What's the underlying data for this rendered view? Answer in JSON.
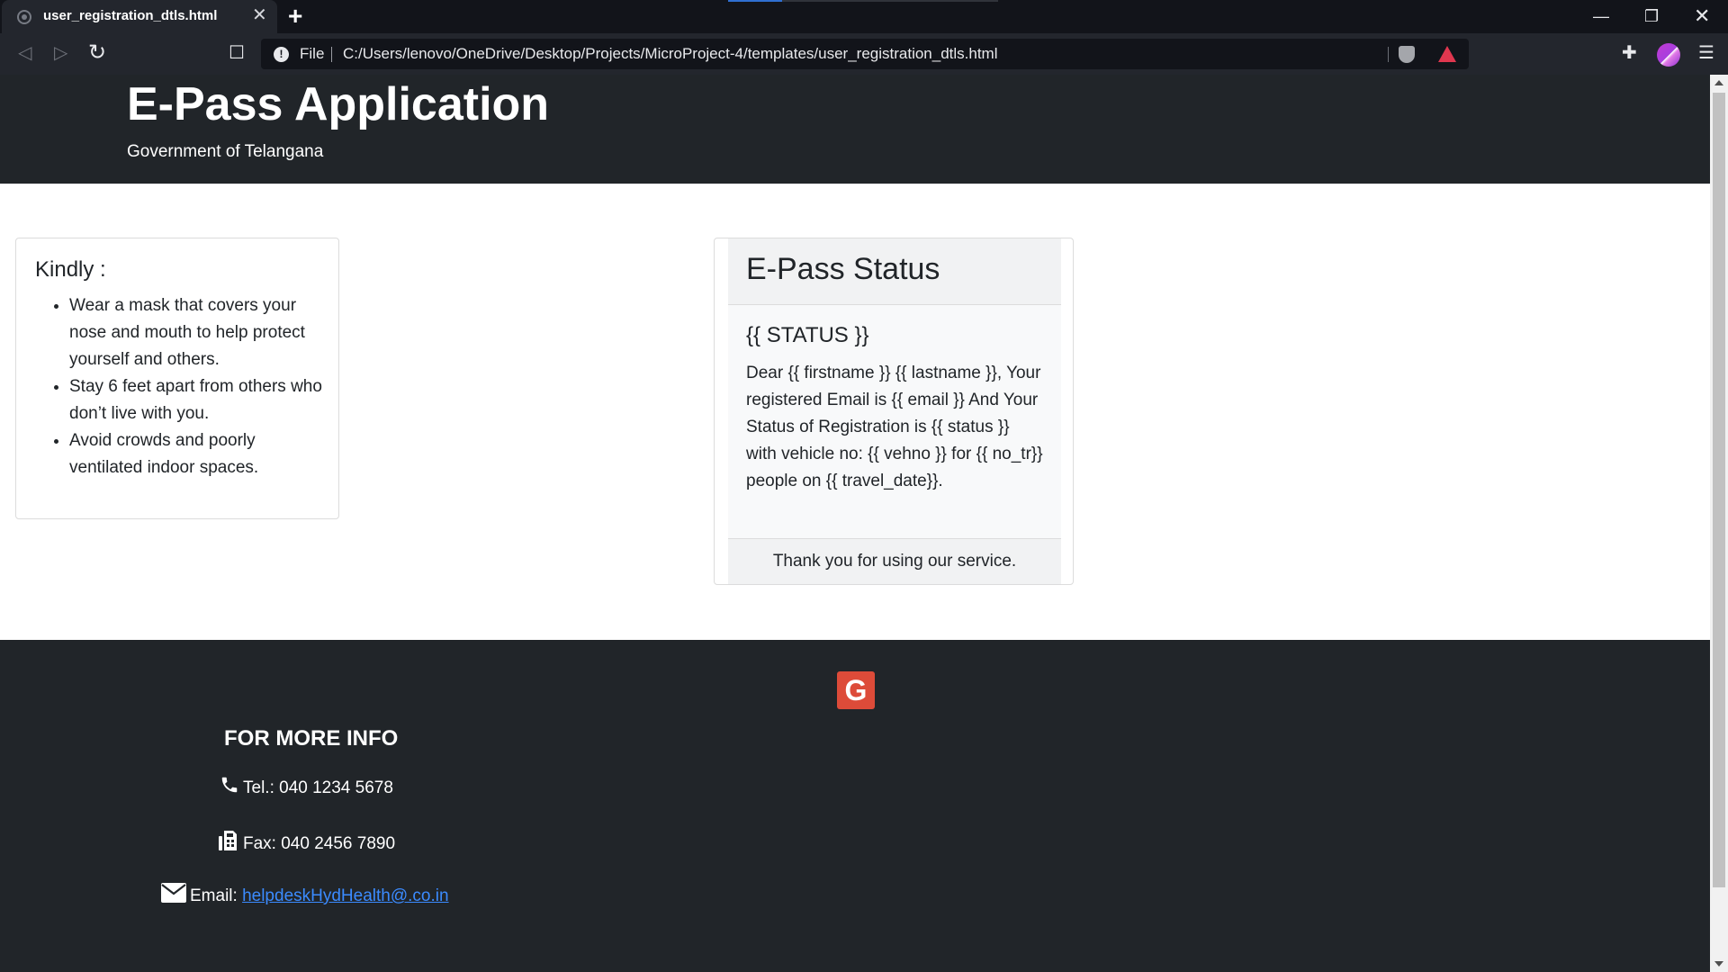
{
  "browser": {
    "tab_title": "user_registration_dtls.html",
    "tab_close": "✕",
    "new_tab": "+",
    "file_label": "File",
    "url": "C:/Users/lenovo/OneDrive/Desktop/Projects/MicroProject-4/templates/user_registration_dtls.html",
    "window_minimize": "—",
    "window_restore": "❐",
    "window_close": "✕"
  },
  "header": {
    "title": "E-Pass Application",
    "subtitle": "Government of Telangana"
  },
  "kindly": {
    "title": "Kindly :",
    "items": [
      "Wear a mask that covers your nose and mouth to help protect yourself and others.",
      "Stay 6 feet apart from others who don’t live with you.",
      "Avoid crowds and poorly ventilated indoor spaces."
    ]
  },
  "status_card": {
    "header": "E-Pass Status",
    "heading": "{{ STATUS }}",
    "body": "Dear {{ firstname }} {{ lastname }}, Your registered Email is {{ email }} And Your Status of Registration is {{ status }} with vehicle no: {{ vehno }} for {{ no_tr}} people on {{ travel_date}}.",
    "footer": "Thank you for using our service."
  },
  "footer": {
    "google_glyph": "G",
    "more_info": "FOR MORE INFO",
    "tel": "Tel.: 040 1234 5678",
    "fax": "Fax: 040 2456 7890",
    "email_label": "Email:",
    "email_link": "helpdeskHydHealth@.co.in"
  },
  "icons": {
    "phone": "phone-icon",
    "fax": "fax-icon",
    "email": "envelope-icon",
    "google": "google-icon"
  },
  "colors": {
    "header_bg": "#212529",
    "footer_bg": "#212529",
    "link": "#3b8bff",
    "google": "#dd4b39"
  }
}
